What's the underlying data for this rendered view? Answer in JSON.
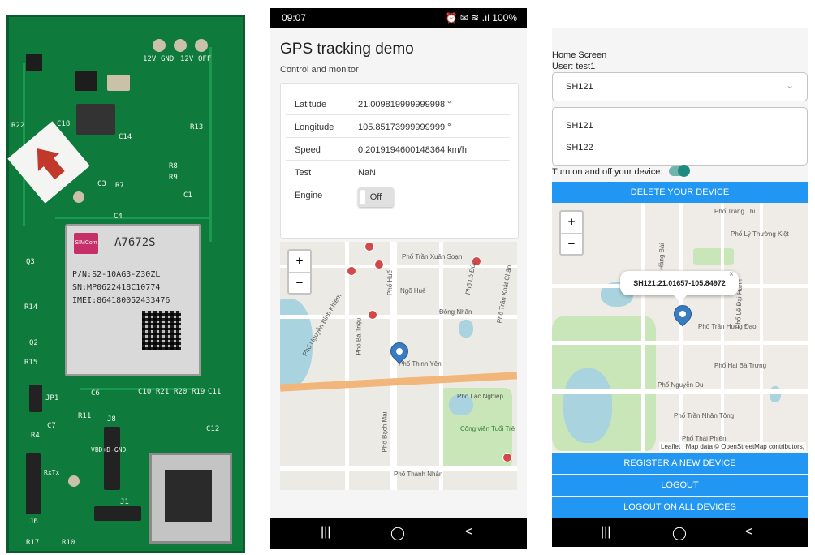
{
  "pcb": {
    "module_brand": "SIMCom",
    "module_model": "A7672S",
    "module_pn": "P/N:S2-10AG3-Z30ZL",
    "module_sn": "SN:MP0622418C10774",
    "module_imei": "IMEI:864180052433476",
    "labels": [
      "12V",
      "GND",
      "12V",
      "OFF",
      "C18",
      "C14",
      "R22",
      "R13",
      "R8",
      "R9",
      "C3",
      "R7",
      "C1",
      "C4",
      "Q3",
      "R14",
      "Q2",
      "R15",
      "JP1",
      "C7",
      "R4",
      "R11",
      "C6",
      "C10",
      "R21",
      "R20",
      "R19",
      "C11",
      "C12",
      "J8",
      "J6",
      "R17",
      "R10",
      "J1",
      "VBD+D-GND",
      "RxTx"
    ]
  },
  "phone1": {
    "status": {
      "time": "09:07",
      "icons": "⏰ ✉ ≋ .ıl 100%"
    },
    "title": "GPS tracking demo",
    "subtitle": "Control and monitor",
    "rows": [
      {
        "label": "Latitude",
        "value": "21.009819999999998 °"
      },
      {
        "label": "Longitude",
        "value": "105.85173999999999 °"
      },
      {
        "label": "Speed",
        "value": "0.2019194600148364 km/h"
      },
      {
        "label": "Test",
        "value": "NaN"
      },
      {
        "label": "Engine",
        "value": "Off"
      }
    ],
    "map": {
      "zoom_in": "+",
      "zoom_out": "−",
      "labels": [
        "Phố Trần Xuân Soạn",
        "Phố Huế",
        "Phố Lò Đúc",
        "Ngõ Huế",
        "Đông Nhân",
        "Phố Bà Triệu",
        "Phố Nguyễn Bỉnh Khiêm",
        "Phố Thịnh Yên",
        "Phố Bạch Mai",
        "Phố Lạc Nghiệp",
        "Công viên Tuổi Trẻ",
        "Phố Thanh Nhàn",
        "Phố Trần Khát Chân"
      ]
    },
    "nav": {
      "recent": "|||",
      "home": "◯",
      "back": "<"
    }
  },
  "phone2": {
    "home_label": "Home Screen",
    "user_label": "User: test1",
    "selected_device": "SH121",
    "devices": [
      "SH121",
      "SH122"
    ],
    "toggle_label": "Turn on and off your device:",
    "delete_button": "DELETE YOUR DEVICE",
    "popup": "SH121:21.01657-105.84972",
    "popup_close": "×",
    "map": {
      "zoom_in": "+",
      "zoom_out": "−",
      "attribution": "Leaflet | Map data © OpenStreetMap contributors,",
      "labels": [
        "Phố Hàng Bài",
        "Phố Lý Thường Kiệt",
        "Phố Trần Hưng Đạo",
        "Phố Hai Bà Trưng",
        "Phố Tràng Thi",
        "Phố Nguyễn Du",
        "Phố Trần Nhân Tông",
        "Phố Lê Đại Hành",
        "Phố Thái Phiên"
      ]
    },
    "register_button": "REGISTER A NEW DEVICE",
    "logout_button": "LOGOUT",
    "logout_all_button": "LOGOUT ON ALL DEVICES",
    "nav": {
      "recent": "|||",
      "home": "◯",
      "back": "<"
    }
  },
  "colors": {
    "accent_blue": "#2196f3",
    "pcb_green": "#0e7a3c",
    "toggle_teal": "#1f8a7e"
  }
}
